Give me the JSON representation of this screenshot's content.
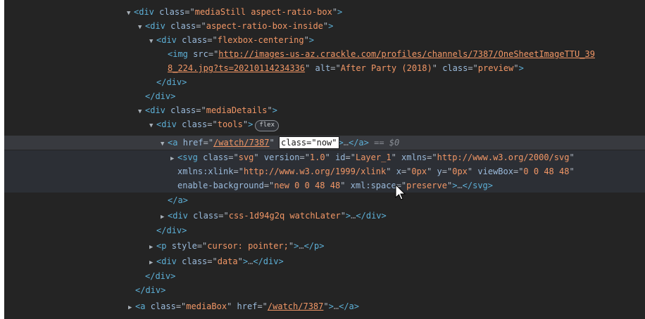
{
  "lines": {
    "l01": {
      "tag": "div",
      "attr": "class",
      "val": "mediaStill aspect-ratio-box"
    },
    "l02": {
      "tag": "div",
      "attr": "class",
      "val": "aspect-ratio-box-inside"
    },
    "l03": {
      "tag": "div",
      "attr": "class",
      "val": "flexbox-centering"
    },
    "l04": {
      "tag": "img",
      "src_attr": "src",
      "src_val_a": "http://images-us-az.crackle.com/profiles/channels/7387/OneSheetImageTTU_39",
      "src_val_b": "8_224.jpg?ts=20210114234336",
      "alt_attr": "alt",
      "alt_val": "After Party (2018)",
      "class_attr": "class",
      "class_val": "preview"
    },
    "l06": {
      "close": "</div>"
    },
    "l07": {
      "close": "</div>"
    },
    "l08": {
      "tag": "div",
      "attr": "class",
      "val": "mediaDetails"
    },
    "l09": {
      "tag": "div",
      "attr": "class",
      "val": "tools",
      "badge": "flex"
    },
    "l10": {
      "tag": "a",
      "attr": "href",
      "val": "/watch/7387",
      "edit_attr": "class",
      "edit_val": "\"now\"",
      "ellipsis": "…",
      "close": "</a>",
      "eq_sign": "==",
      "dollar": "$0"
    },
    "l11": {
      "tag": "svg",
      "a1": "class",
      "v1": "svg",
      "a2": "version",
      "v2": "1.0",
      "a3": "id",
      "v3": "Layer_1",
      "a4": "xmlns",
      "v4": "http://www.w3.org/2000/svg"
    },
    "l12": {
      "a1": "xmlns:xlink",
      "v1": "http://www.w3.org/1999/xlink",
      "a2": "x",
      "v2": "0px",
      "a3": "y",
      "v3": "0px",
      "a4": "viewBox",
      "v4": "0 0 48 48"
    },
    "l13": {
      "a1": "enable-background",
      "v1": "new 0 0 48 48",
      "a2": "xml:space",
      "v2": "preserve",
      "ellipsis": "…",
      "close": "</svg>"
    },
    "l14": {
      "close": "</a>"
    },
    "l15": {
      "tag": "div",
      "attr": "class",
      "val": "css-1d94g2q watchLater",
      "ellipsis": "…",
      "close": "</div>"
    },
    "l16": {
      "close": "</div>"
    },
    "l17": {
      "tag": "p",
      "attr": "style",
      "val": "cursor: pointer;",
      "ellipsis": "…",
      "close": "</p>"
    },
    "l18": {
      "tag": "div",
      "attr": "class",
      "val": "data",
      "ellipsis": "…",
      "close": "</div>"
    },
    "l19": {
      "close": "</div>"
    },
    "l20": {
      "close": "</div>"
    },
    "l21": {
      "tag": "a",
      "attr": "class",
      "val": "mediaBox",
      "attr2": "href",
      "val2": "/watch/7387",
      "ellipsis": "…",
      "close": "</a>"
    }
  },
  "icons": {
    "expanded": "▼",
    "collapsed": "▶",
    "pointer": "mouse-cursor-icon"
  },
  "colors": {
    "tag": "#5db0d7",
    "attr": "#9bbbdc",
    "value": "#f29766",
    "background": "#242424",
    "selected_row": "#383a3f"
  }
}
